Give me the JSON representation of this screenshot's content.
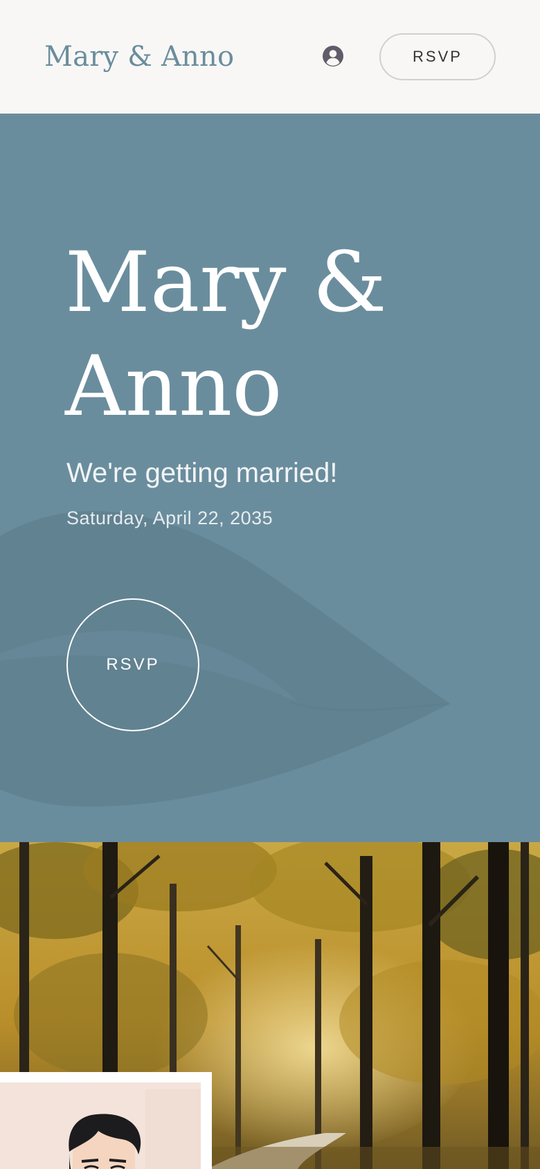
{
  "header": {
    "brand": "Mary & Anno",
    "account_icon": "account-circle-icon",
    "rsvp_label": "RSVP"
  },
  "hero": {
    "title": "Mary &\nAnno",
    "tagline": "We're getting married!",
    "date": "Saturday, April 22, 2035",
    "rsvp_label": "RSVP"
  },
  "colors": {
    "brand": "#6a8d9d",
    "hero_background": "#6a8d9d",
    "page_background": "#f8f7f5",
    "text_light": "#ffffff",
    "button_border": "#d2d0cd"
  }
}
